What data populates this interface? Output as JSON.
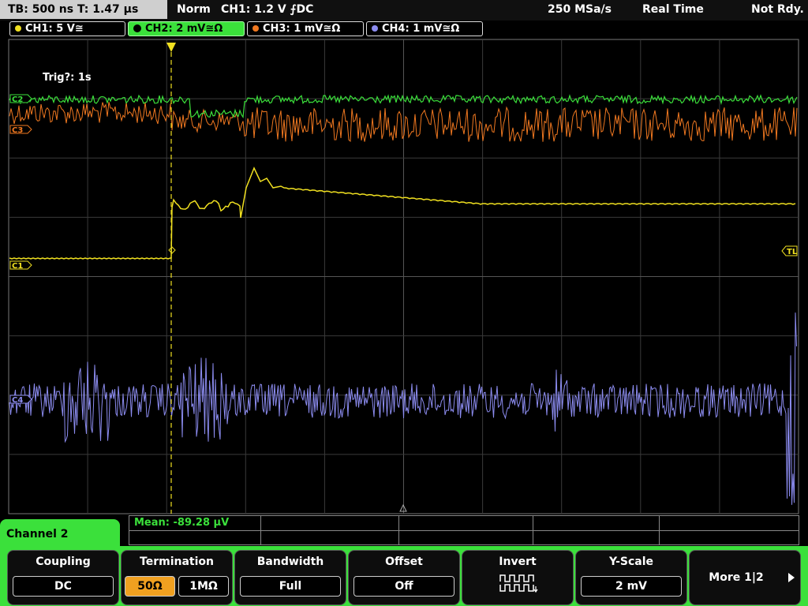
{
  "topbar": {
    "timebase": "TB: 500 ns   T: 1.47 µs",
    "mode": "Norm",
    "trigger": "CH1: 1.2 V ⨍DC",
    "sample_rate": "250 MSa/s",
    "acq_mode": "Real Time",
    "status": "Not Rdy."
  },
  "channels": [
    {
      "label": "CH1: 5 V≅",
      "color": "#f0e020"
    },
    {
      "label": "CH2: 2 mV≅Ω",
      "color": "#3be03b"
    },
    {
      "label": "CH3: 1 mV≅Ω",
      "color": "#f07820"
    },
    {
      "label": "CH4: 1 mV≅Ω",
      "color": "#8c8cf0"
    }
  ],
  "scope": {
    "trig_info": "Trig?: 1s",
    "markers": {
      "c3": "C3",
      "c2": "C2",
      "c1": "C1",
      "c4": "C4",
      "tl": "TL"
    }
  },
  "panel": {
    "channel_title": "Channel 2",
    "mean": "Mean: -89.28 µV"
  },
  "softkeys": {
    "coupling": {
      "title": "Coupling",
      "value": "DC"
    },
    "termination": {
      "title": "Termination",
      "opt1": "50Ω",
      "opt2": "1MΩ"
    },
    "bandwidth": {
      "title": "Bandwidth",
      "value": "Full"
    },
    "offset": {
      "title": "Offset",
      "value": "Off"
    },
    "invert": {
      "title": "Invert",
      "icon": "invert-waveform-icon"
    },
    "yscale": {
      "title": "Y-Scale",
      "value": "2 mV"
    },
    "more": {
      "label": "More 1|2"
    }
  }
}
